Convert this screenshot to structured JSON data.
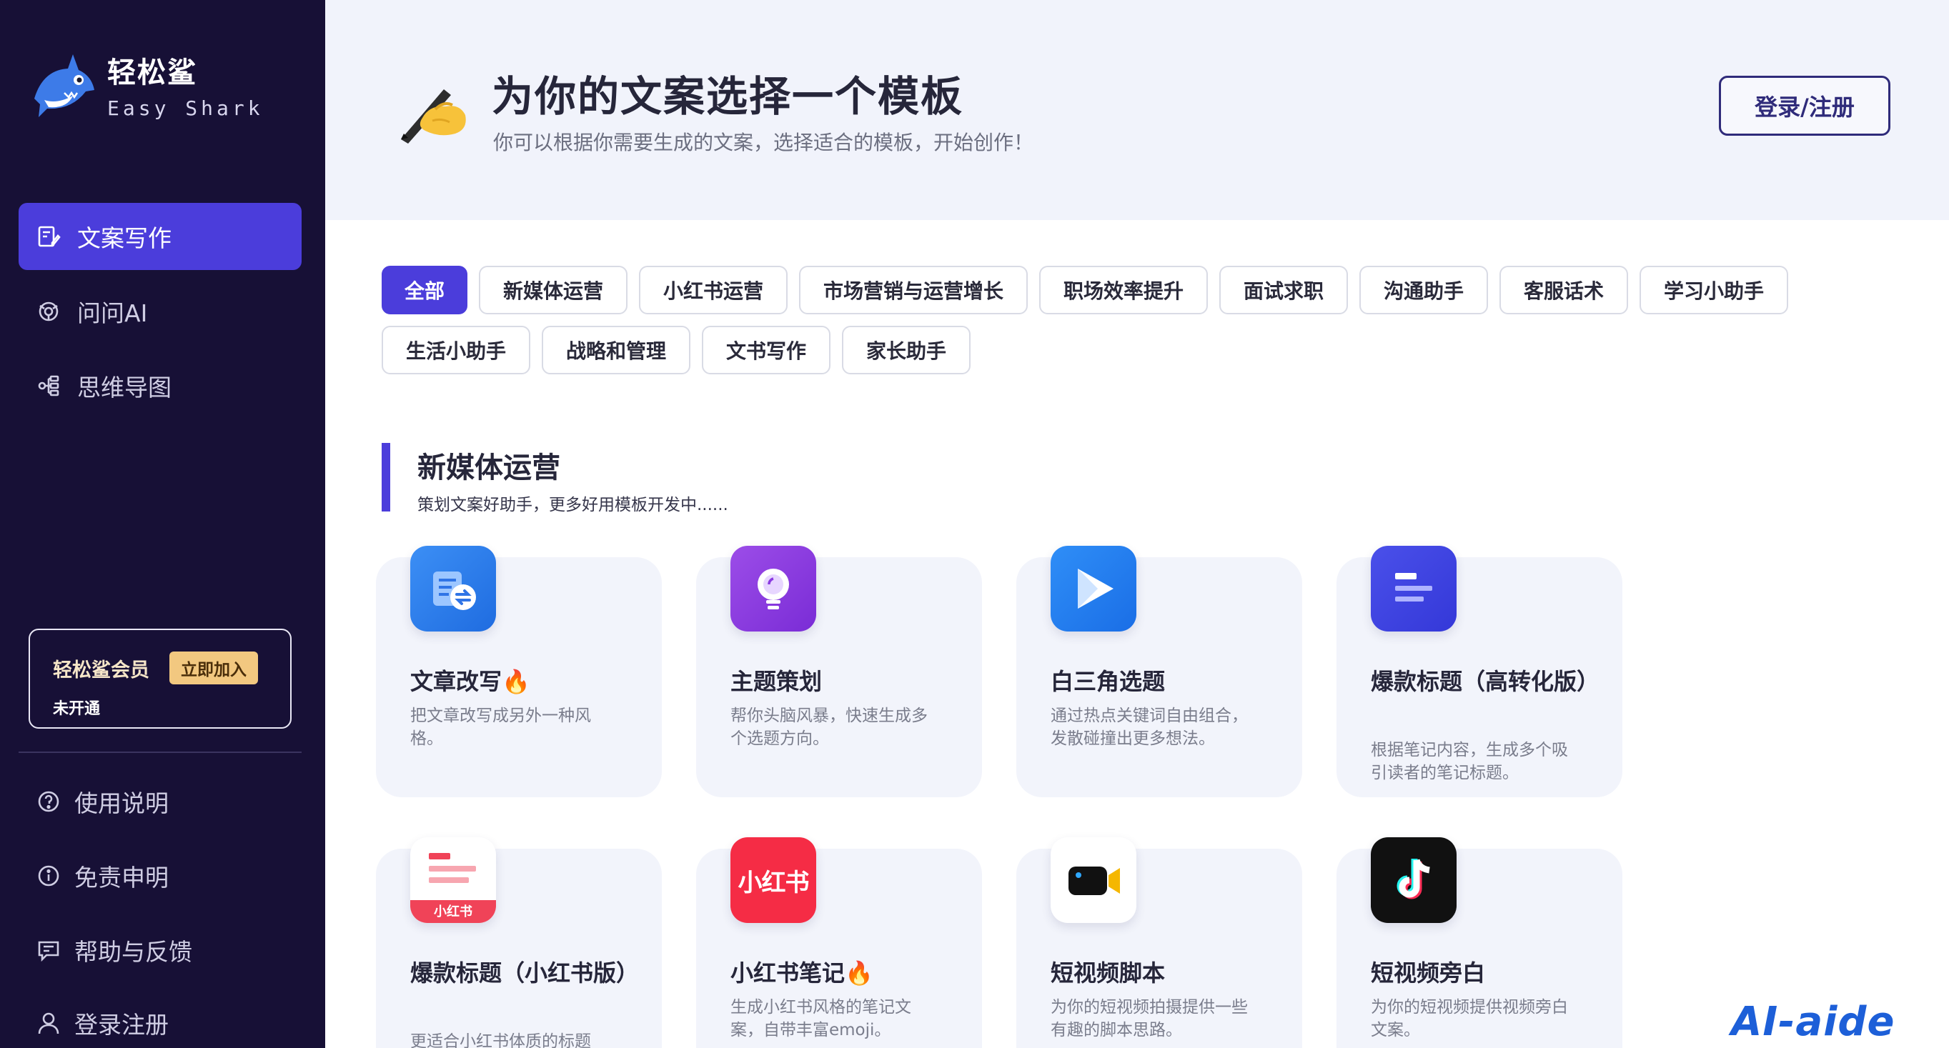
{
  "brand": {
    "name_cn": "轻松鲨",
    "name_en": "Easy Shark"
  },
  "sidebar": {
    "nav": [
      {
        "label": "文案写作",
        "icon": "edit-doc-icon",
        "active": true
      },
      {
        "label": "问问AI",
        "icon": "ai-chat-icon",
        "active": false
      },
      {
        "label": "思维导图",
        "icon": "mindmap-icon",
        "active": false
      }
    ],
    "member": {
      "title": "轻松鲨会员",
      "join_label": "立即加入",
      "status": "未开通"
    },
    "footer": [
      {
        "label": "使用说明",
        "icon": "help-circle-icon"
      },
      {
        "label": "免责申明",
        "icon": "info-circle-icon"
      },
      {
        "label": "帮助与反馈",
        "icon": "feedback-icon"
      },
      {
        "label": "登录注册",
        "icon": "user-icon"
      }
    ]
  },
  "header": {
    "title": "为你的文案选择一个模板",
    "subtitle": "你可以根据你需要生成的文案，选择适合的模板，开始创作！",
    "login_label": "登录/注册",
    "emoji_icon": "writing-hand-icon"
  },
  "categories": [
    {
      "label": "全部",
      "active": true
    },
    {
      "label": "新媒体运营"
    },
    {
      "label": "小红书运营"
    },
    {
      "label": "市场营销与运营增长"
    },
    {
      "label": "职场效率提升"
    },
    {
      "label": "面试求职"
    },
    {
      "label": "沟通助手"
    },
    {
      "label": "客服话术"
    },
    {
      "label": "学习小助手"
    },
    {
      "label": "生活小助手"
    },
    {
      "label": "战略和管理"
    },
    {
      "label": "文书写作"
    },
    {
      "label": "家长助手"
    }
  ],
  "section": {
    "title": "新媒体运营",
    "subtitle": "策划文案好助手，更多好用模板开发中......"
  },
  "templates": [
    {
      "title": "文章改写🔥",
      "desc": "把文章改写成另外一种风格。",
      "icon": "document-swap-icon"
    },
    {
      "title": "主题策划",
      "desc": "帮你头脑风暴，快速生成多个选题方向。",
      "icon": "lightbulb-icon"
    },
    {
      "title": "白三角选题",
      "desc": "通过热点关键词自由组合，发散碰撞出更多想法。",
      "icon": "play-triangle-icon"
    },
    {
      "title": "爆款标题（高转化版）",
      "desc": "根据笔记内容，生成多个吸引读者的笔记标题。",
      "icon": "text-lines-icon"
    },
    {
      "title": "爆款标题（小红书版）",
      "desc": "更适合小红书体质的标题",
      "icon": "xiaohongshu-title-icon",
      "icon_text": "小红书"
    },
    {
      "title": "小红书笔记🔥",
      "desc": "生成小红书风格的笔记文案，自带丰富emoji。",
      "icon": "xiaohongshu-icon",
      "icon_text": "小红书"
    },
    {
      "title": "短视频脚本",
      "desc": "为你的短视频拍摄提供一些有趣的脚本思路。",
      "icon": "video-camera-icon"
    },
    {
      "title": "短视频旁白",
      "desc": "为你的短视频提供视频旁白文案。",
      "icon": "tiktok-icon"
    }
  ],
  "watermark": "AI-aide"
}
